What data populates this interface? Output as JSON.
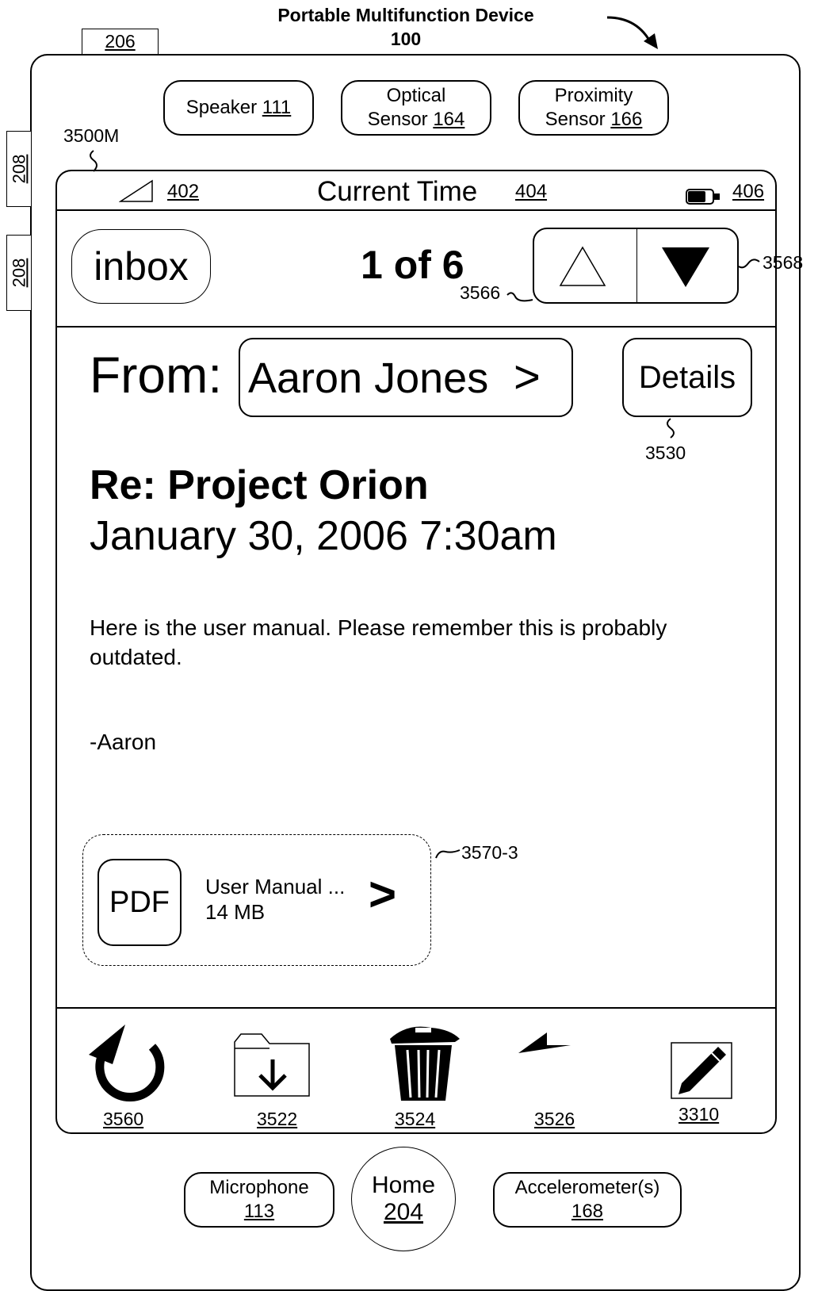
{
  "header": {
    "title": "Portable Multifunction Device",
    "ref": "100"
  },
  "refs": {
    "r206": "206",
    "r208a": "208",
    "r208b": "208",
    "screen": "3500M",
    "nav_buttons": "3568",
    "up_button": "3566",
    "details_button": "3530",
    "attachment": "3570-3"
  },
  "hardware": {
    "speaker": {
      "label": "Speaker",
      "ref": "111"
    },
    "optical": {
      "label1": "Optical",
      "label2": "Sensor",
      "ref": "164"
    },
    "proximity": {
      "label1": "Proximity",
      "label2": "Sensor",
      "ref": "166"
    },
    "microphone": {
      "label": "Microphone",
      "ref": "113"
    },
    "home": {
      "label": "Home",
      "ref": "204"
    },
    "accelerometer": {
      "label": "Accelerometer(s)",
      "ref": "168"
    }
  },
  "status_bar": {
    "signal_ref": "402",
    "time": "Current Time",
    "time_ref": "404",
    "battery_ref": "406"
  },
  "nav": {
    "inbox": "inbox",
    "counter": "1 of 6"
  },
  "message": {
    "from_label": "From:",
    "sender": "Aaron Jones",
    "sender_chevron": ">",
    "details": "Details",
    "subject": "Re: Project Orion",
    "date": "January 30, 2006 7:30am",
    "body_line1": "Here is the user manual. Please remember this is probably",
    "body_line2": "outdated.",
    "signature": "-Aaron"
  },
  "attachment": {
    "type": "PDF",
    "name": "User Manual ...",
    "size": "14 MB",
    "chevron": ">"
  },
  "toolbar": [
    {
      "icon": "refresh-icon",
      "ref": "3560"
    },
    {
      "icon": "move-to-folder-icon",
      "ref": "3522"
    },
    {
      "icon": "trash-icon",
      "ref": "3524"
    },
    {
      "icon": "reply-icon",
      "ref": "3526"
    },
    {
      "icon": "compose-icon",
      "ref": "3310"
    }
  ]
}
